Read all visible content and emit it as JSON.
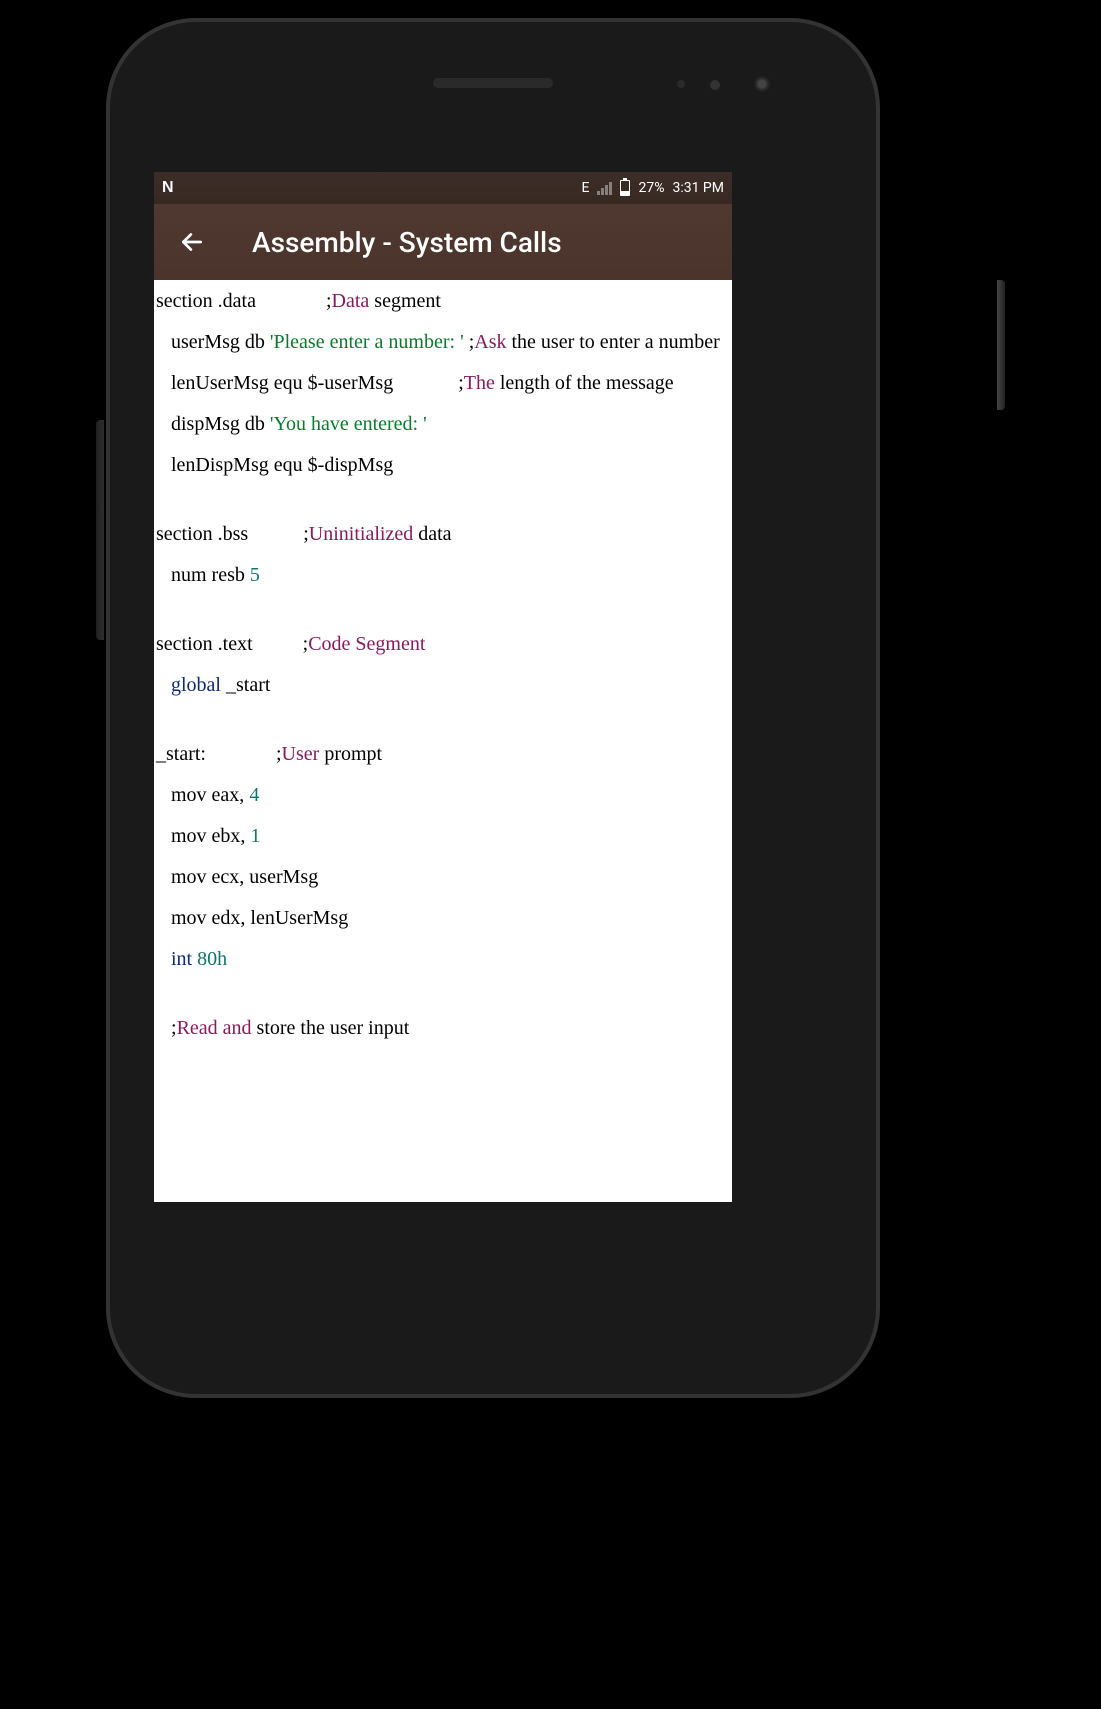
{
  "statusbar": {
    "network_type": "E",
    "battery_percent": "27%",
    "time": "3:31 PM"
  },
  "appbar": {
    "title": "Assembly - System Calls"
  },
  "code": {
    "l1_a": "section .data              ;",
    "l1_kw": "Data",
    "l1_b": " segment",
    "l2_a": "   userMsg db ",
    "l2_str": "'Please enter a number: '",
    "l2_semi": " ;",
    "l2_kw": "Ask",
    "l2_b": " the user to enter a number",
    "l3_a": "   lenUserMsg equ $-userMsg             ;",
    "l3_kw": "The",
    "l3_b": " length of the message",
    "l4_a": "   dispMsg db ",
    "l4_str": "'You have entered: '",
    "l5": "   lenDispMsg equ $-dispMsg",
    "l6_a": "section .bss           ;",
    "l6_kw": "Uninitialized",
    "l6_b": " data",
    "l7_a": "   num resb ",
    "l7_n": "5",
    "l8_a": "section .text          ;",
    "l8_kw": "Code Segment",
    "l9_kw": "   global",
    "l9_b": " _start",
    "l10_a": "_start:              ;",
    "l10_kw": "User",
    "l10_b": " prompt",
    "l11_a": "   mov eax, ",
    "l11_n": "4",
    "l12_a": "   mov ebx, ",
    "l12_n": "1",
    "l13": "   mov ecx, userMsg",
    "l14": "   mov edx, lenUserMsg",
    "l15_kw": "   int ",
    "l15_n": "80h",
    "l16_a": "   ;",
    "l16_kw": "Read and",
    "l16_b": " store the user input"
  }
}
